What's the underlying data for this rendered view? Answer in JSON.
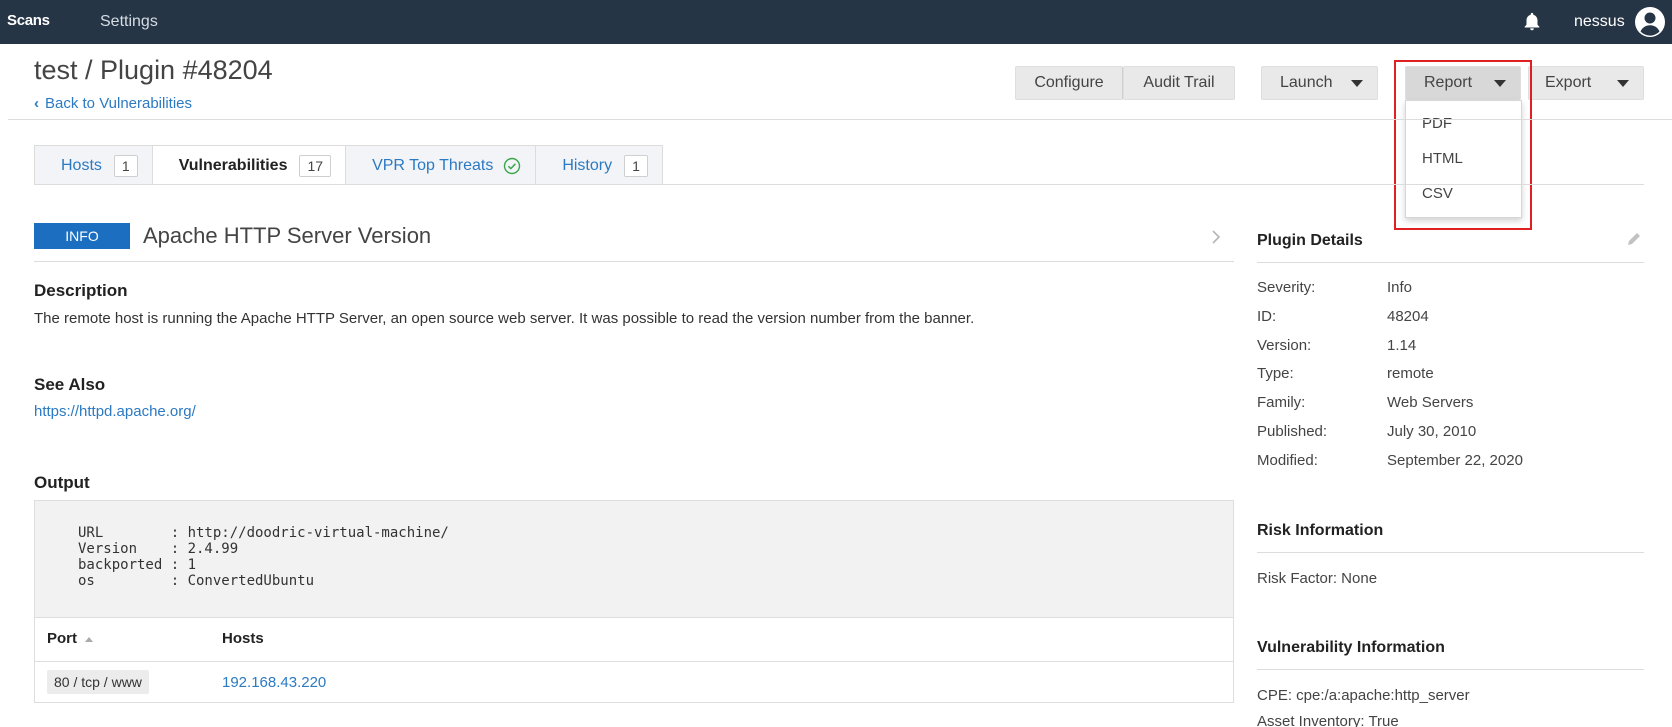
{
  "topbar": {
    "brand": "Scans",
    "settings": "Settings",
    "username": "nessus"
  },
  "header": {
    "title": "test / Plugin #48204",
    "back_link": "Back to Vulnerabilities",
    "buttons": {
      "configure": "Configure",
      "audit_trail": "Audit Trail",
      "launch": "Launch",
      "report": "Report",
      "export": "Export"
    },
    "report_menu": [
      "PDF",
      "HTML",
      "CSV"
    ]
  },
  "tabs": [
    {
      "label": "Hosts",
      "count": "1"
    },
    {
      "label": "Vulnerabilities",
      "count": "17"
    },
    {
      "label": "VPR Top Threats"
    },
    {
      "label": "History",
      "count": "1"
    }
  ],
  "plugin": {
    "severity": "INFO",
    "name": "Apache HTTP Server Version",
    "description_title": "Description",
    "description": "The remote host is running the Apache HTTP Server, an open source web server. It was possible to read the version number from the banner.",
    "see_also_title": "See Also",
    "see_also_link": "https://httpd.apache.org/",
    "output_title": "Output",
    "output_text": "URL        : http://doodric-virtual-machine/\nVersion    : 2.4.99\nbackported : 1\nos         : ConvertedUbuntu",
    "table": {
      "col_port": "Port",
      "col_hosts": "Hosts",
      "rows": [
        {
          "port": "80 / tcp / www",
          "host": "192.168.43.220"
        }
      ]
    }
  },
  "sidebar": {
    "plugin_details_title": "Plugin Details",
    "details": [
      {
        "label": "Severity:",
        "value": "Info"
      },
      {
        "label": "ID:",
        "value": "48204"
      },
      {
        "label": "Version:",
        "value": "1.14"
      },
      {
        "label": "Type:",
        "value": "remote"
      },
      {
        "label": "Family:",
        "value": "Web Servers"
      },
      {
        "label": "Published:",
        "value": "July 30, 2010"
      },
      {
        "label": "Modified:",
        "value": "September 22, 2020"
      }
    ],
    "risk_title": "Risk Information",
    "risk_factor": "Risk Factor: None",
    "vuln_title": "Vulnerability Information",
    "cpe": "CPE: cpe:/a:apache:http_server",
    "asset_inventory": "Asset Inventory: True"
  },
  "colors": {
    "topbar": "#263545",
    "link": "#2b7ac2",
    "info_badge": "#1c6fc0",
    "highlight": "#e02020"
  }
}
